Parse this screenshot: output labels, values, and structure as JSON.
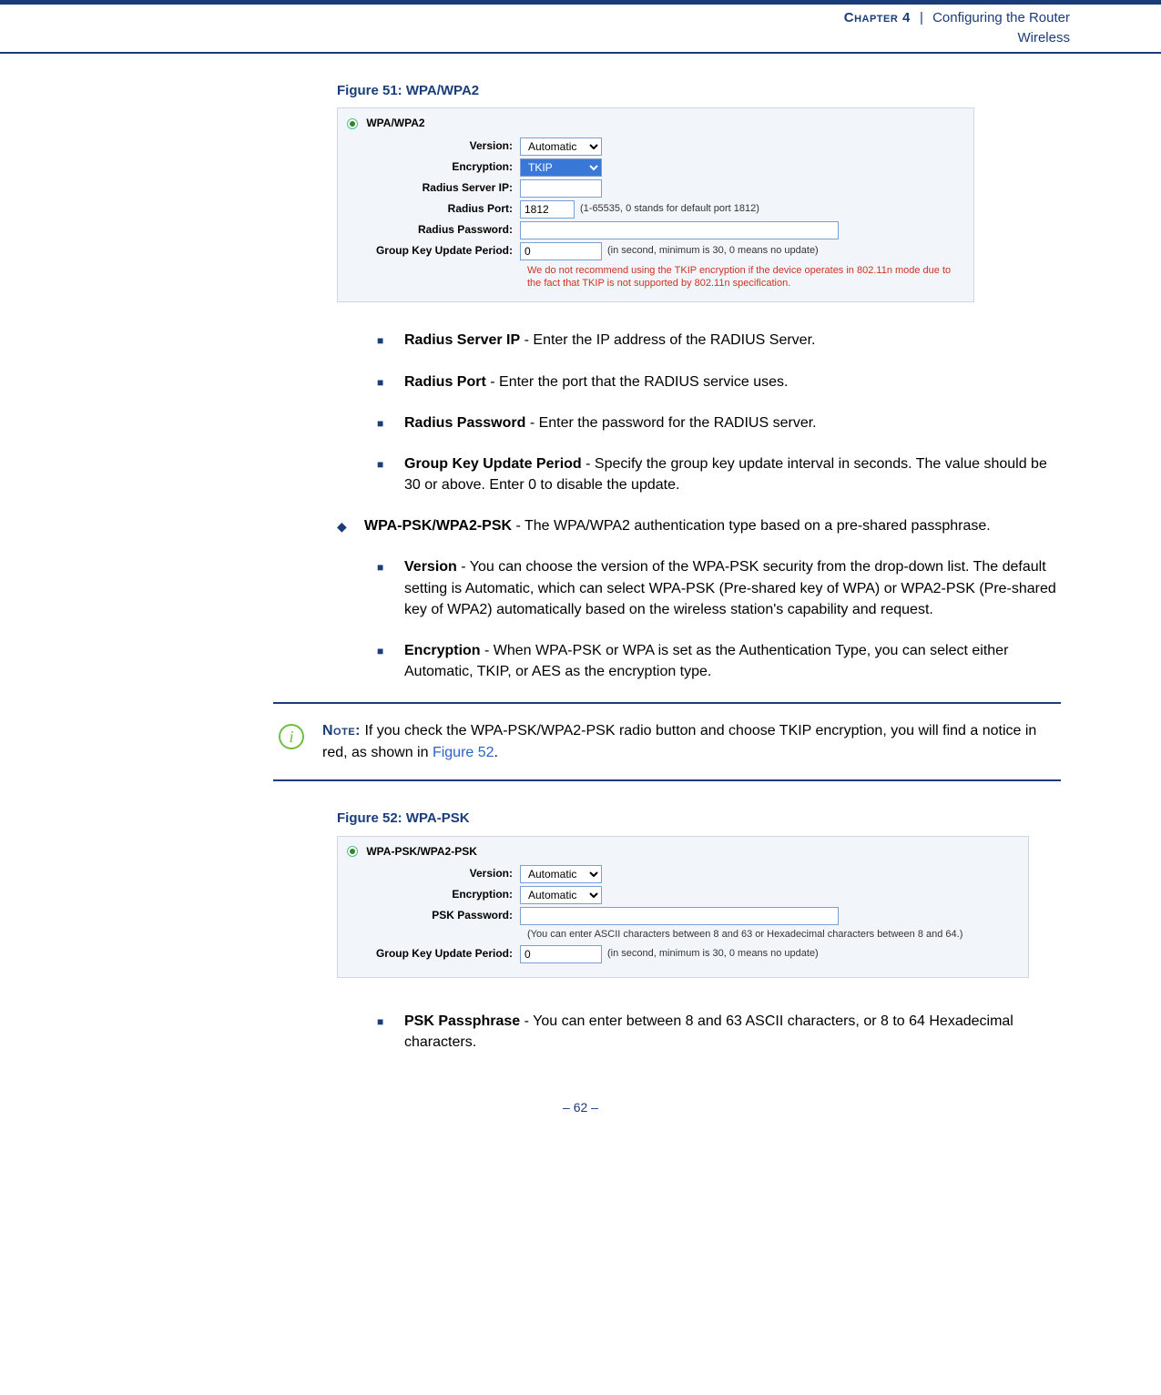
{
  "header": {
    "chapter": "Chapter 4",
    "separator": "|",
    "title": "Configuring the Router",
    "subtitle": "Wireless"
  },
  "figure51": {
    "caption": "Figure 51:  WPA/WPA2",
    "section_header": "WPA/WPA2",
    "rows": {
      "version_label": "Version:",
      "version_value": "Automatic",
      "encryption_label": "Encryption:",
      "encryption_value": "TKIP",
      "radius_ip_label": "Radius Server IP:",
      "radius_ip_value": "",
      "radius_port_label": "Radius Port:",
      "radius_port_value": "1812",
      "radius_port_hint": "(1-65535, 0 stands for default port 1812)",
      "radius_pw_label": "Radius Password:",
      "radius_pw_value": "",
      "gkup_label": "Group Key Update Period:",
      "gkup_value": "0",
      "gkup_hint": "(in second, minimum is 30, 0 means no update)"
    },
    "warning": "We do not recommend using the TKIP encryption if the device operates in 802.11n mode due to the fact that TKIP is not supported by 802.11n specification."
  },
  "bullets": {
    "radius_ip": {
      "term": "Radius Server IP",
      "text": " - Enter the IP address of the RADIUS Server."
    },
    "radius_port": {
      "term": "Radius Port",
      "text": " - Enter the port that the RADIUS service uses."
    },
    "radius_pw": {
      "term": "Radius Password",
      "text": " - Enter the password for the RADIUS server."
    },
    "gkup": {
      "term": "Group Key Update Period",
      "text": " - Specify the group key update interval in seconds. The value should be 30 or above. Enter 0 to disable the update."
    },
    "wpa_psk_main": {
      "term": "WPA-PSK/WPA2-PSK",
      "text": " - The WPA/WPA2 authentication type based on a pre-shared passphrase."
    },
    "version": {
      "term": "Version",
      "text": " - You can choose the version of the WPA-PSK security from the drop-down list. The default setting is Automatic, which can select WPA-PSK (Pre-shared key of WPA) or WPA2-PSK (Pre-shared key of WPA2) automatically based on the wireless station's capability and request."
    },
    "encryption": {
      "term": "Encryption",
      "text": " - When WPA-PSK or WPA is set as the Authentication Type, you can select either Automatic, TKIP, or AES as the encryption type."
    },
    "psk_pass": {
      "term": "PSK Passphrase",
      "text": " - You can enter between 8 and 63 ASCII characters, or 8 to 64 Hexadecimal characters."
    }
  },
  "note": {
    "label": "Note:",
    "text_before": " If you check the WPA-PSK/WPA2-PSK radio button and choose TKIP encryption, you will find a notice in red, as shown in ",
    "link": "Figure 52",
    "text_after": "."
  },
  "figure52": {
    "caption": "Figure 52:  WPA-PSK",
    "section_header": "WPA-PSK/WPA2-PSK",
    "rows": {
      "version_label": "Version:",
      "version_value": "Automatic",
      "encryption_label": "Encryption:",
      "encryption_value": "Automatic",
      "psk_pw_label": "PSK Password:",
      "psk_pw_value": "",
      "psk_hint": "(You can enter ASCII characters between 8 and 63 or Hexadecimal characters between 8 and 64.)",
      "gkup_label": "Group Key Update Period:",
      "gkup_value": "0",
      "gkup_hint": "(in second, minimum is 30, 0 means no update)"
    }
  },
  "footer": {
    "page": "–  62  –"
  }
}
